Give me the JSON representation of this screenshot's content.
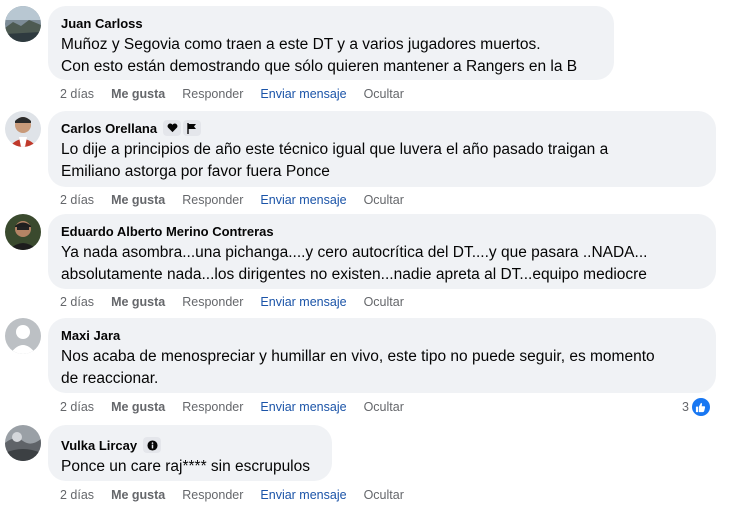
{
  "comments": [
    {
      "name": "Juan Carloss",
      "badges": [],
      "text": "Muñoz y Segovia como traen a este DT y a varios jugadores muertos.\nCon esto están demostrando que sólo quieren mantener a Rangers en la B",
      "time": "2 días",
      "like": "Me gusta",
      "reply": "Responder",
      "send": "Enviar mensaje",
      "hide": "Ocultar"
    },
    {
      "name": "Carlos Orellana",
      "badges": [
        "heart-handshake-icon",
        "flag-icon"
      ],
      "text": "Lo dije a principios de año este técnico igual que luvera el año pasado traigan a\nEmiliano astorga por favor fuera Ponce",
      "time": "2 días",
      "like": "Me gusta",
      "reply": "Responder",
      "send": "Enviar mensaje",
      "hide": "Ocultar"
    },
    {
      "name": "Eduardo Alberto Merino Contreras",
      "badges": [],
      "text": "Ya nada asombra...una pichanga....y cero autocrítica del DT....y que pasara ..NADA...\nabsolutamente nada...los dirigentes no existen...nadie apreta al DT...equipo mediocre",
      "time": "2 días",
      "like": "Me gusta",
      "reply": "Responder",
      "send": "Enviar mensaje",
      "hide": "Ocultar"
    },
    {
      "name": "Maxi Jara",
      "badges": [],
      "text": "Nos acaba de menospreciar y humillar en vivo, este tipo no puede seguir, es momento\nde reaccionar.",
      "time": "2 días",
      "like": "Me gusta",
      "reply": "Responder",
      "send": "Enviar mensaje",
      "hide": "Ocultar",
      "reaction_count": "3"
    },
    {
      "name": "Vulka Lircay",
      "badges": [
        "info-icon"
      ],
      "text": "Ponce un care raj**** sin escrupulos",
      "time": "2 días",
      "like": "Me gusta",
      "reply": "Responder",
      "send": "Enviar mensaje",
      "hide": "Ocultar"
    }
  ],
  "colors": {
    "bubble": "#f0f2f5",
    "meta": "#65676b",
    "link": "#1b54a8",
    "like_blue": "#1877f2"
  }
}
